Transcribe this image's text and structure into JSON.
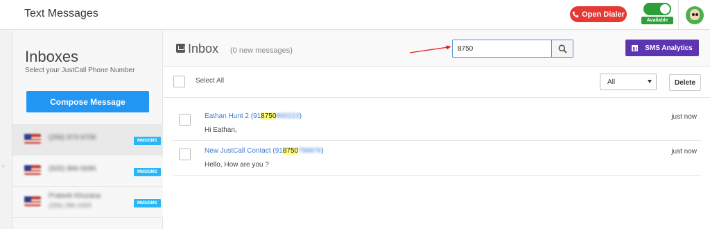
{
  "header": {
    "title": "Text Messages",
    "dialer_label": "Open Dialer",
    "status_label": "Available"
  },
  "sidebar": {
    "title": "Inboxes",
    "subtitle": "Select your JustCall Phone Number",
    "compose_label": "Compose Message",
    "numbers": [
      {
        "number": "(256) 973-9706",
        "tag": "MMS/SMS"
      },
      {
        "number": "(505) 966-5696",
        "tag": "MMS/SMS"
      },
      {
        "name": "Prateek Khurana",
        "number": "(256) 286-1909",
        "tag": "MMS/SMS"
      }
    ]
  },
  "inbox": {
    "title": "Inbox",
    "count": "(0 new messages)",
    "search_value": "8750",
    "analytics_label": "SMS Analytics",
    "select_all_label": "Select All",
    "filter_value": "All",
    "delete_label": "Delete"
  },
  "messages": [
    {
      "name_prefix": "Eathan Hunt 2 (91",
      "highlight": "8750",
      "number_rest": "800223",
      "close": ")",
      "body": "Hi Eathan,",
      "time": "just now"
    },
    {
      "name_prefix": "New JustCall Contact (91",
      "highlight": "8750",
      "number_rest": "799976",
      "close": ")",
      "body": "Hello, How are you ?",
      "time": "just now"
    }
  ],
  "colors": {
    "dialer": "#e53935",
    "available": "#2e9e3a",
    "compose": "#2196f3",
    "analytics": "#5e35b1",
    "link": "#3a7bd5",
    "highlight": "#ffff80",
    "tag": "#29b6f6"
  }
}
